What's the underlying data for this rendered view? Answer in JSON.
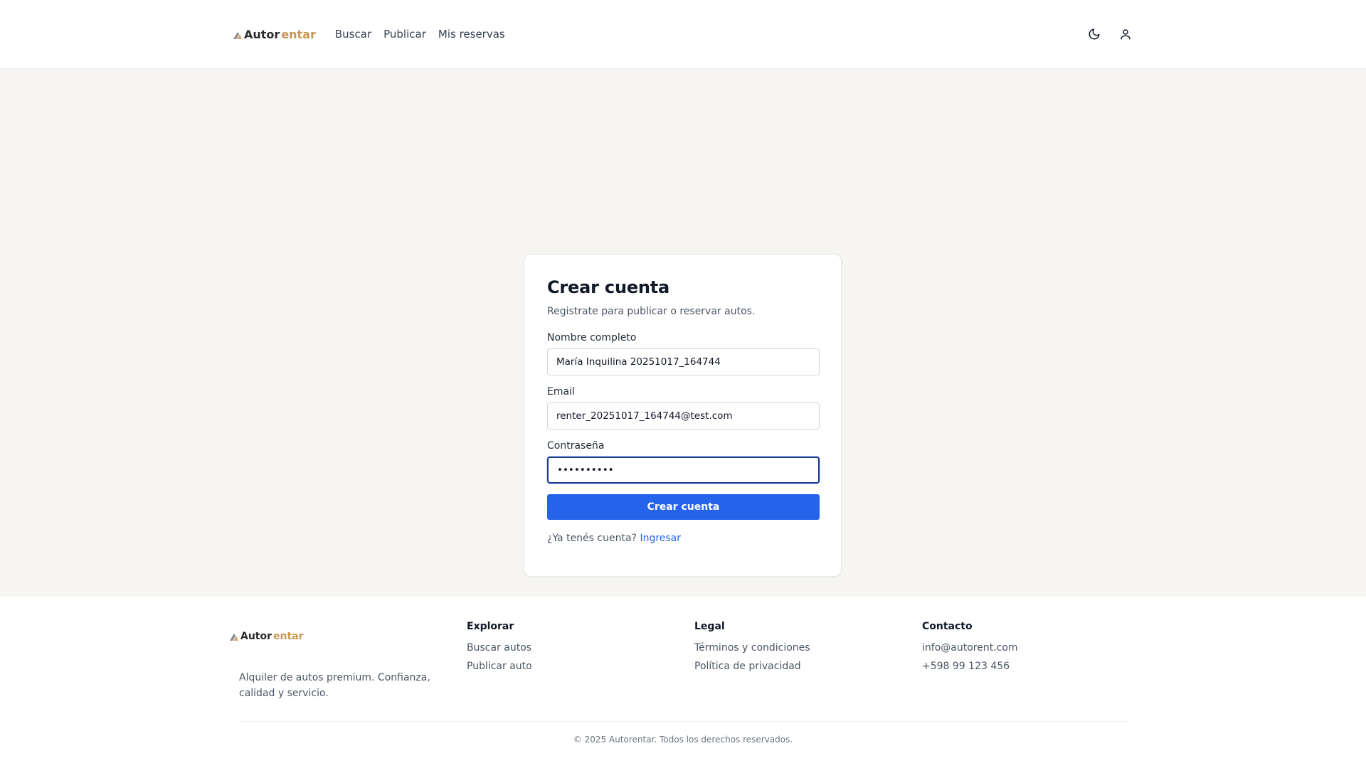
{
  "header": {
    "logo": {
      "part1": "Autor",
      "part2": "entar"
    },
    "nav": [
      "Buscar",
      "Publicar",
      "Mis reservas"
    ],
    "icons": [
      "moon-icon",
      "user-icon"
    ]
  },
  "form": {
    "title": "Crear cuenta",
    "subtitle": "Registrate para publicar o reservar autos.",
    "name_label": "Nombre completo",
    "name_value": "María Inquilina 20251017_164744",
    "email_label": "Email",
    "email_value": "renter_20251017_164744@test.com",
    "password_label": "Contraseña",
    "password_value": "••••••••••",
    "submit_label": "Crear cuenta",
    "login_prompt": "¿Ya tenés cuenta?",
    "login_link": "Ingresar"
  },
  "footer": {
    "logo": {
      "part1": "Autor",
      "part2": "entar"
    },
    "description": "Alquiler de autos premium. Confianza, calidad y servicio.",
    "columns": [
      {
        "title": "Explorar",
        "links": [
          "Buscar autos",
          "Publicar auto"
        ]
      },
      {
        "title": "Legal",
        "links": [
          "Términos y condiciones",
          "Política de privacidad"
        ]
      },
      {
        "title": "Contacto",
        "links": [
          "info@autorent.com",
          "+598 99 123 456"
        ]
      }
    ],
    "copyright": "© 2025 Autorentar. Todos los derechos reservados."
  },
  "colors": {
    "accent": "#2563eb",
    "brand_gold": "#c9944f",
    "background": "#f6f5f2"
  }
}
